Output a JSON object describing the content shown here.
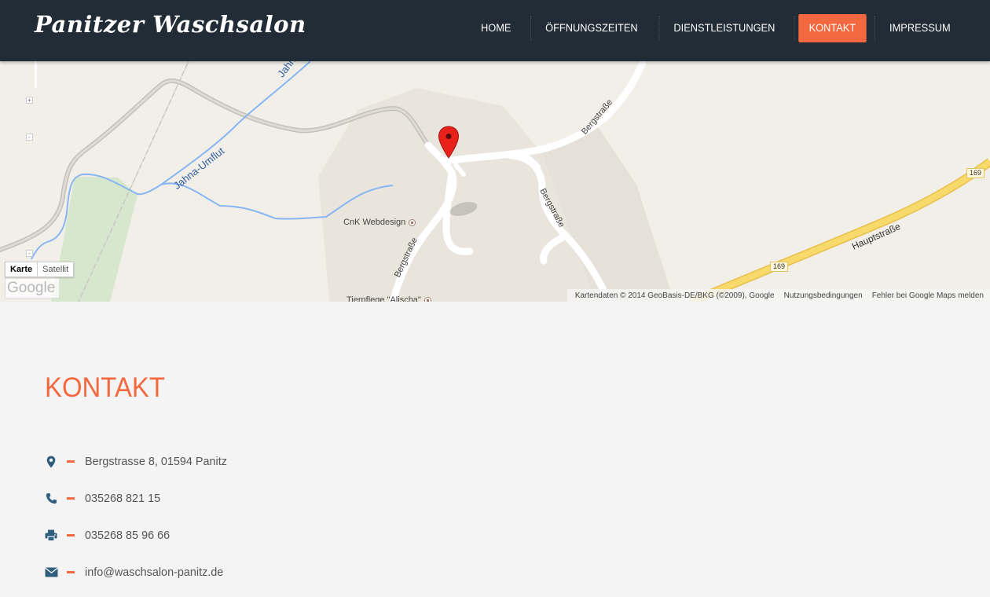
{
  "header": {
    "logo": "Panitzer Waschsalon",
    "nav": [
      {
        "label": "HOME",
        "active": false
      },
      {
        "label": "ÖFFNUNGSZEITEN",
        "active": false
      },
      {
        "label": "DIENSTLEISTUNGEN",
        "active": false
      },
      {
        "label": "KONTAKT",
        "active": true
      },
      {
        "label": "IMPRESSUM",
        "active": false
      }
    ]
  },
  "map": {
    "map_type_buttons": [
      "Karte",
      "Satellit"
    ],
    "google_logo": "Google",
    "labels": {
      "river": "Jahna-Umflut",
      "river_top": "Jahna-U",
      "street_1": "Bergstraße",
      "street_2": "Bergstraße",
      "street_3": "Bergstraße",
      "main_road": "Hauptstraße",
      "route_1": "169",
      "route_2": "169",
      "poi_1": "CnK Webdesign",
      "poi_2": "Tierpflege \"Alischa\""
    },
    "attribution": [
      "Kartendaten © 2014 GeoBasis-DE/BKG (©2009), Google",
      "Nutzungsbedingungen",
      "Fehler bei Google Maps melden"
    ],
    "colors": {
      "land": "#f2efe9",
      "built_area": "#e9e5dc",
      "park": "#d6e7cd",
      "water": "#88b6f2",
      "highway": "#f8d96c",
      "road": "#ffffff",
      "marker": "#e8211b"
    }
  },
  "contact": {
    "title": "KONTAKT",
    "items": [
      {
        "icon": "location-pin-icon",
        "text": "Bergstrasse 8, 01594 Panitz"
      },
      {
        "icon": "phone-icon",
        "text": "035268 821 15"
      },
      {
        "icon": "fax-printer-icon",
        "text": "035268 85 96 66"
      },
      {
        "icon": "envelope-icon",
        "text": "info@waschsalon-panitz.de"
      }
    ]
  },
  "colors": {
    "accent": "#f4683f",
    "header_bg": "#212c36",
    "icon": "#2f5d7c",
    "page_bg": "#f4f4f4",
    "text": "#555555"
  }
}
